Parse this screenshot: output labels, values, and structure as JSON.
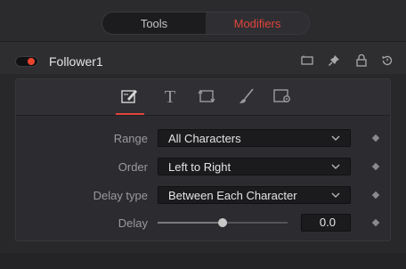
{
  "tabs": {
    "tools_label": "Tools",
    "modifiers_label": "Modifiers",
    "active": "Modifiers"
  },
  "node": {
    "name": "Follower1",
    "enabled": true
  },
  "header_icons": [
    "view-icon",
    "pin-icon",
    "lock-icon",
    "reset-icon"
  ],
  "panel_tabs": [
    {
      "name": "text-controls-tab",
      "icon": "pencil-box-icon",
      "active": true
    },
    {
      "name": "text-tab",
      "icon": "T-icon",
      "active": false
    },
    {
      "name": "transform-tab",
      "icon": "transform-icon",
      "active": false
    },
    {
      "name": "shading-tab",
      "icon": "brush-icon",
      "active": false
    },
    {
      "name": "settings-tab",
      "icon": "settings-box-icon",
      "active": false
    }
  ],
  "params": {
    "range": {
      "label": "Range",
      "value": "All Characters"
    },
    "order": {
      "label": "Order",
      "value": "Left to Right"
    },
    "delay_type": {
      "label": "Delay type",
      "value": "Between Each Character"
    },
    "delay": {
      "label": "Delay",
      "value": "0.0",
      "slider_fraction": 0.5
    }
  },
  "colors": {
    "accent": "#e0443a",
    "background": "#28282b"
  }
}
